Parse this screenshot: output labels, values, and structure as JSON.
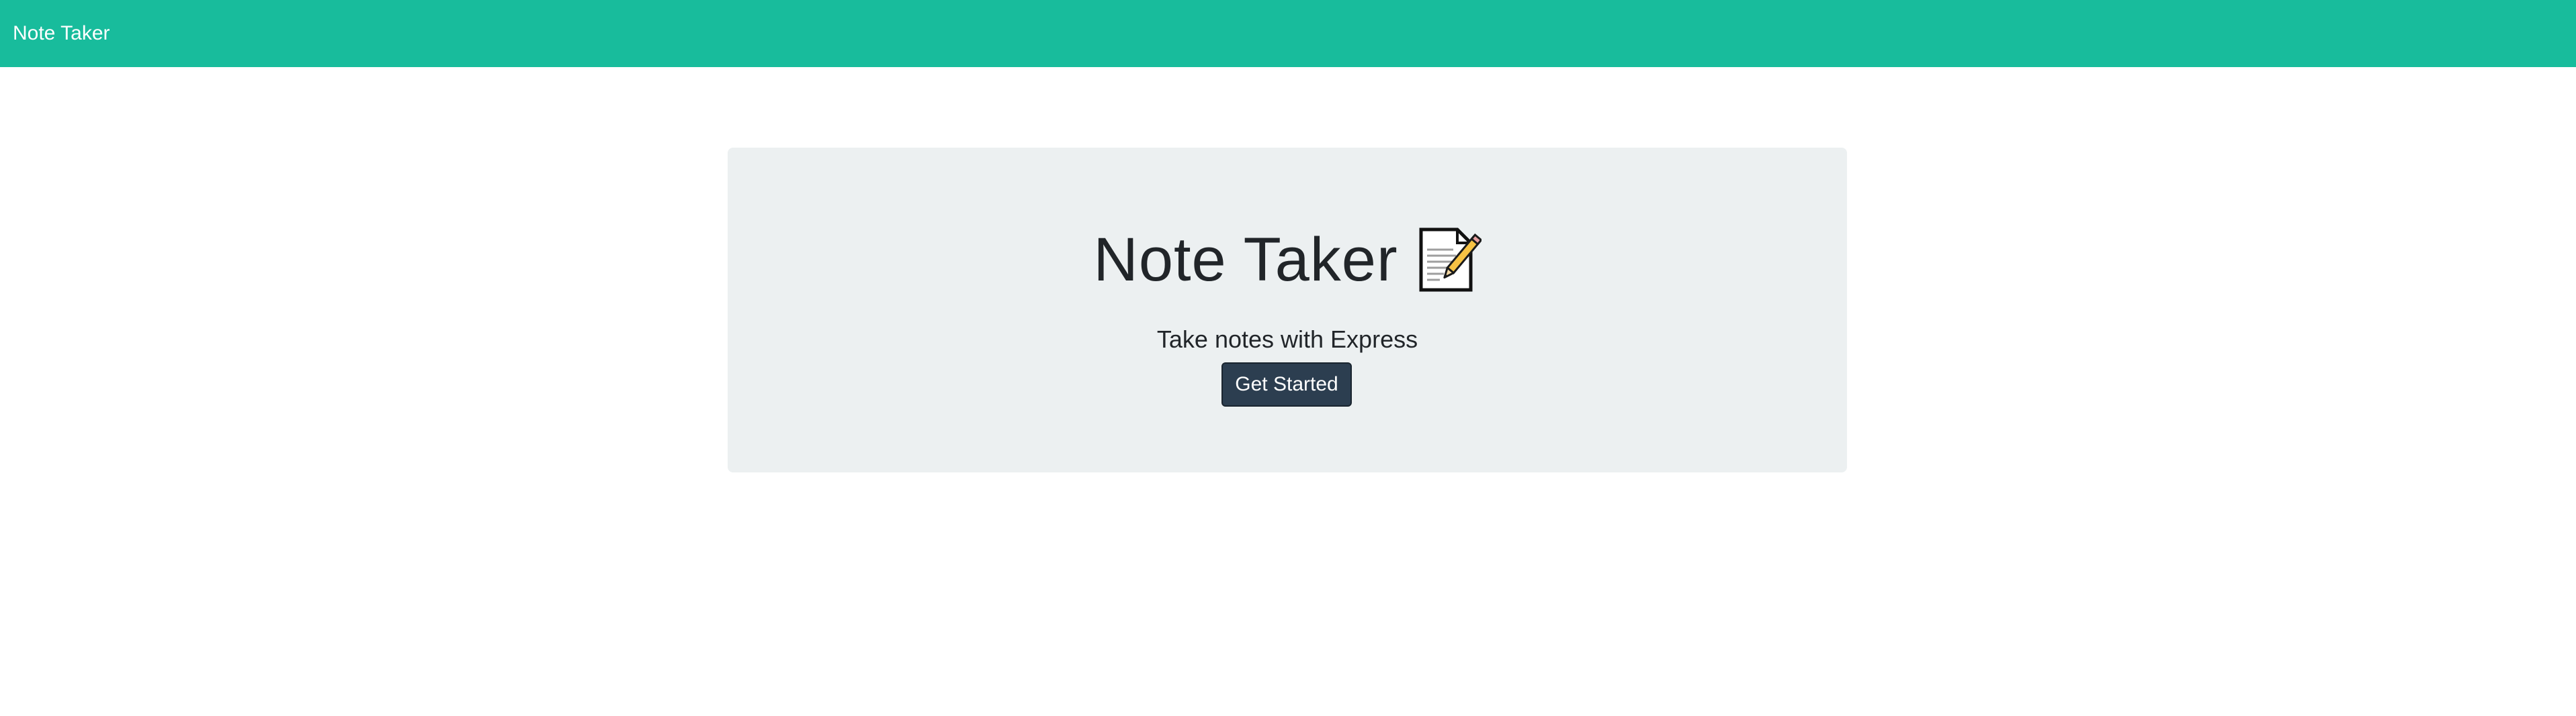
{
  "navbar": {
    "brand": "Note Taker",
    "background_color": "#18bc9c"
  },
  "jumbotron": {
    "title": "Note Taker",
    "title_icon": "memo-icon",
    "subtitle": "Take notes with Express",
    "cta_label": "Get Started",
    "background_color": "#ecf0f1",
    "cta_color": "#2c3e50"
  }
}
